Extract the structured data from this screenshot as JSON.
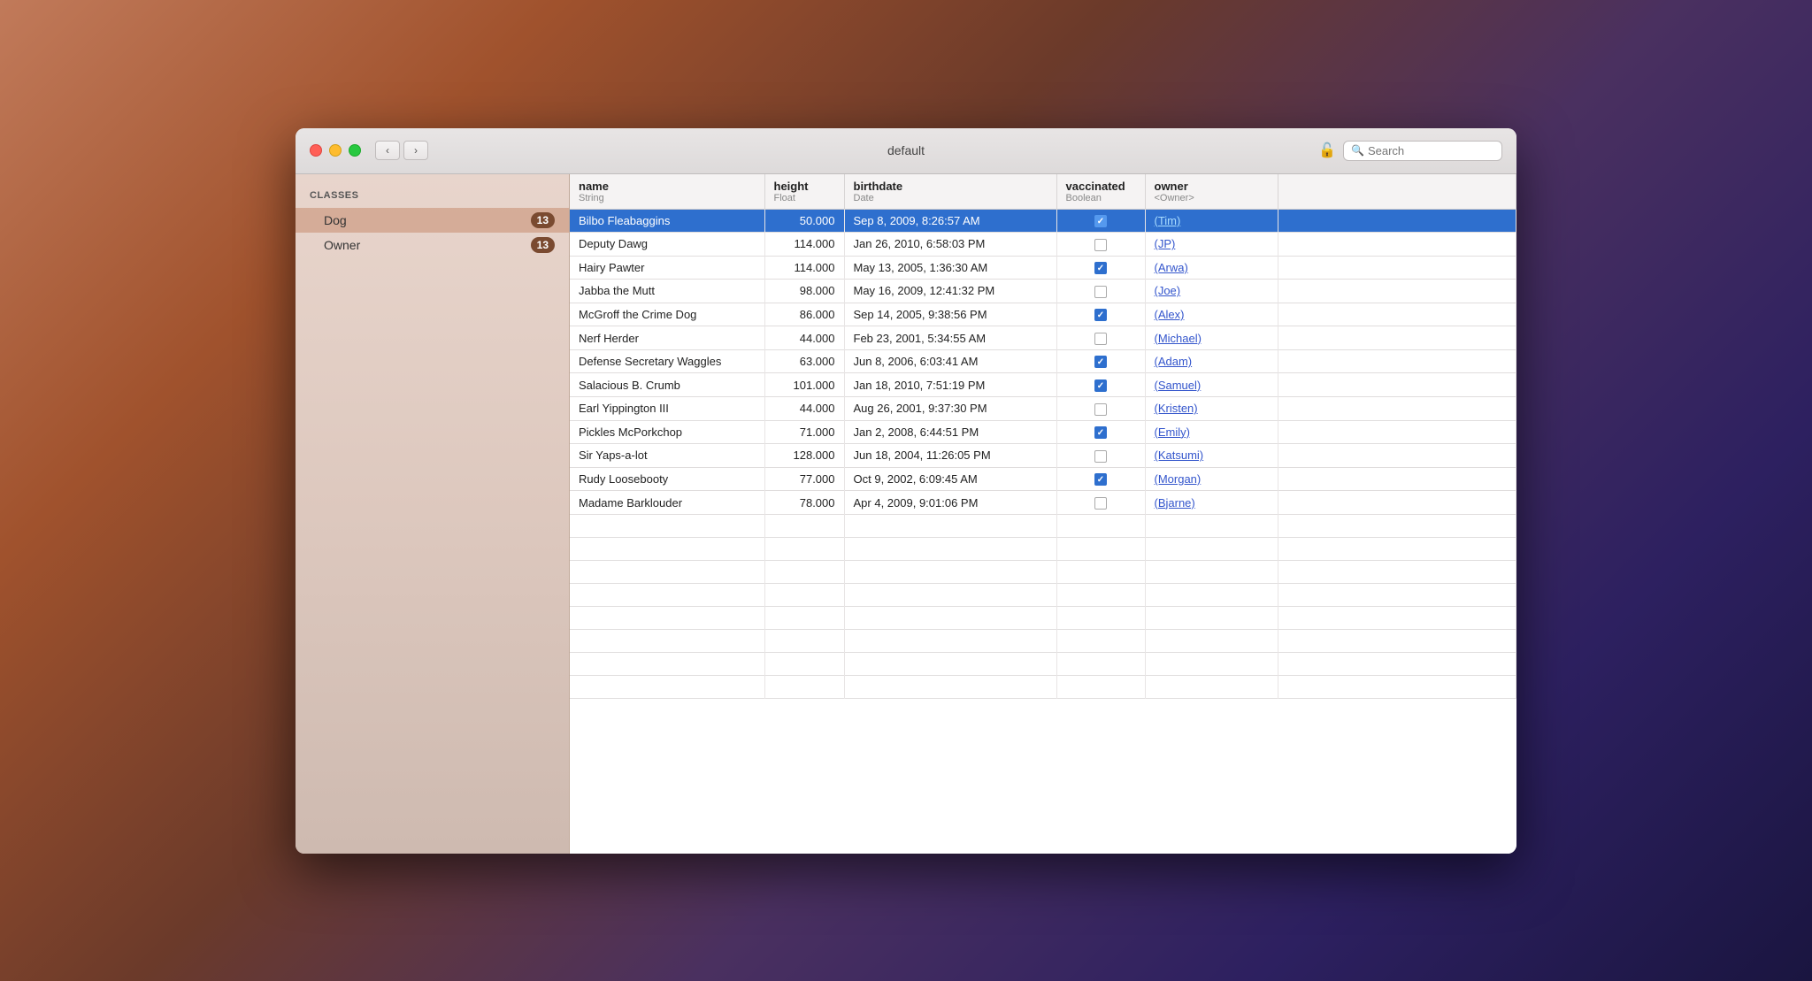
{
  "window": {
    "title": "default"
  },
  "titlebar": {
    "back_label": "‹",
    "forward_label": "›",
    "search_placeholder": "Search"
  },
  "sidebar": {
    "classes_header": "CLASSES",
    "items": [
      {
        "label": "Dog",
        "count": "13",
        "active": true
      },
      {
        "label": "Owner",
        "count": "13",
        "active": false
      }
    ]
  },
  "table": {
    "columns": [
      {
        "name": "name",
        "type": "String"
      },
      {
        "name": "height",
        "type": "Float"
      },
      {
        "name": "birthdate",
        "type": "Date"
      },
      {
        "name": "vaccinated",
        "type": "Boolean"
      },
      {
        "name": "owner",
        "type": "<Owner>"
      }
    ],
    "rows": [
      {
        "name": "Bilbo Fleabaggins",
        "height": "50.000",
        "birthdate": "Sep 8, 2009, 8:26:57 AM",
        "vaccinated": true,
        "owner": "(Tim)",
        "selected": true
      },
      {
        "name": "Deputy Dawg",
        "height": "114.000",
        "birthdate": "Jan 26, 2010, 6:58:03 PM",
        "vaccinated": false,
        "owner": "(JP)",
        "selected": false
      },
      {
        "name": "Hairy Pawter",
        "height": "114.000",
        "birthdate": "May 13, 2005, 1:36:30 AM",
        "vaccinated": true,
        "owner": "(Arwa)",
        "selected": false
      },
      {
        "name": "Jabba the Mutt",
        "height": "98.000",
        "birthdate": "May 16, 2009, 12:41:32 PM",
        "vaccinated": false,
        "owner": "(Joe)",
        "selected": false
      },
      {
        "name": "McGroff the Crime Dog",
        "height": "86.000",
        "birthdate": "Sep 14, 2005, 9:38:56 PM",
        "vaccinated": true,
        "owner": "(Alex)",
        "selected": false
      },
      {
        "name": "Nerf Herder",
        "height": "44.000",
        "birthdate": "Feb 23, 2001, 5:34:55 AM",
        "vaccinated": false,
        "owner": "(Michael)",
        "selected": false
      },
      {
        "name": "Defense Secretary Waggles",
        "height": "63.000",
        "birthdate": "Jun 8, 2006, 6:03:41 AM",
        "vaccinated": true,
        "owner": "(Adam)",
        "selected": false
      },
      {
        "name": "Salacious B. Crumb",
        "height": "101.000",
        "birthdate": "Jan 18, 2010, 7:51:19 PM",
        "vaccinated": true,
        "owner": "(Samuel)",
        "selected": false
      },
      {
        "name": "Earl Yippington III",
        "height": "44.000",
        "birthdate": "Aug 26, 2001, 9:37:30 PM",
        "vaccinated": false,
        "owner": "(Kristen)",
        "selected": false
      },
      {
        "name": "Pickles McPorkchop",
        "height": "71.000",
        "birthdate": "Jan 2, 2008, 6:44:51 PM",
        "vaccinated": true,
        "owner": "(Emily)",
        "selected": false
      },
      {
        "name": "Sir Yaps-a-lot",
        "height": "128.000",
        "birthdate": "Jun 18, 2004, 11:26:05 PM",
        "vaccinated": false,
        "owner": "(Katsumi)",
        "selected": false
      },
      {
        "name": "Rudy Loosebooty",
        "height": "77.000",
        "birthdate": "Oct 9, 2002, 6:09:45 AM",
        "vaccinated": true,
        "owner": "(Morgan)",
        "selected": false
      },
      {
        "name": "Madame Barklouder",
        "height": "78.000",
        "birthdate": "Apr 4, 2009, 9:01:06 PM",
        "vaccinated": false,
        "owner": "(Bjarne)",
        "selected": false
      }
    ]
  }
}
